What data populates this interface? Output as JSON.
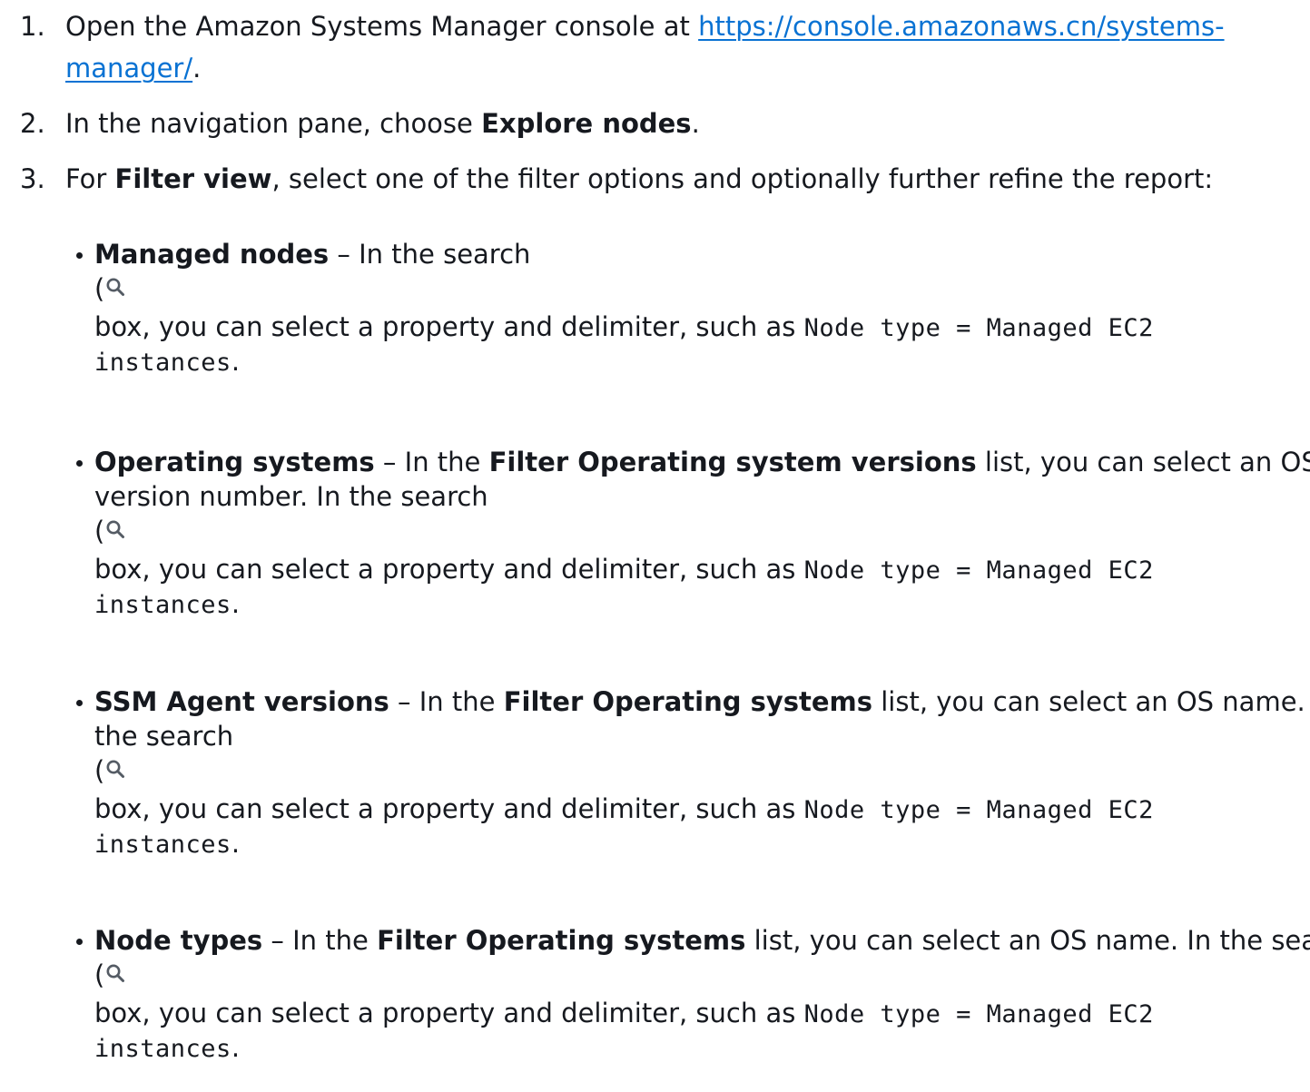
{
  "steps": [
    {
      "num": "1.",
      "before": "Open the Amazon Systems Manager console at ",
      "link_line1": "https://console.amazonaws.cn/systems-",
      "link_line2": "manager/",
      "after": "."
    },
    {
      "num": "2.",
      "before": "In the navigation pane, choose ",
      "bold": "Explore nodes",
      "after": "."
    },
    {
      "num": "3.",
      "before": "For ",
      "bold": "Filter view",
      "after": ", select one of the filter options and optionally further refine the report:"
    }
  ],
  "bullets": [
    {
      "title": "Managed nodes",
      "sep": " – ",
      "line1_rest": "In the search",
      "paren": "(",
      "box_text": "box, you can select a property and delimiter, such as ",
      "code_line1": "Node type = Managed EC2",
      "code_line2": "instances",
      "end": "."
    },
    {
      "title": "Operating systems",
      "sep": " – ",
      "text_a": "In the ",
      "bold_a": "Filter Operating system versions",
      "text_b": " list, you can select an OS",
      "line2": "version number. In the search",
      "paren": "(",
      "box_text": "box, you can select a property and delimiter, such as ",
      "code_line1": "Node type = Managed EC2",
      "code_line2": "instances",
      "end": "."
    },
    {
      "title": "SSM Agent versions",
      "sep": " – ",
      "text_a": "In the ",
      "bold_a": "Filter Operating systems",
      "text_b": " list, you can select an OS name. In",
      "line2": "the search",
      "paren": "(",
      "box_text": "box, you can select a property and delimiter, such as ",
      "code_line1": "Node type = Managed EC2",
      "code_line2": "instances",
      "end": "."
    },
    {
      "title": "Node types",
      "sep": " – ",
      "text_a": "In the ",
      "bold_a": "Filter Operating systems",
      "text_b": " list, you can select an OS name. In the search",
      "paren": "(",
      "box_text": "box, you can select a property and delimiter, such as ",
      "code_line1": "Node type = Managed EC2",
      "code_line2": "instances",
      "end": "."
    }
  ],
  "icons": {
    "search": "search-icon"
  },
  "colors": {
    "link": "#0972d3",
    "icon": "#545b64",
    "text": "#16191f"
  }
}
